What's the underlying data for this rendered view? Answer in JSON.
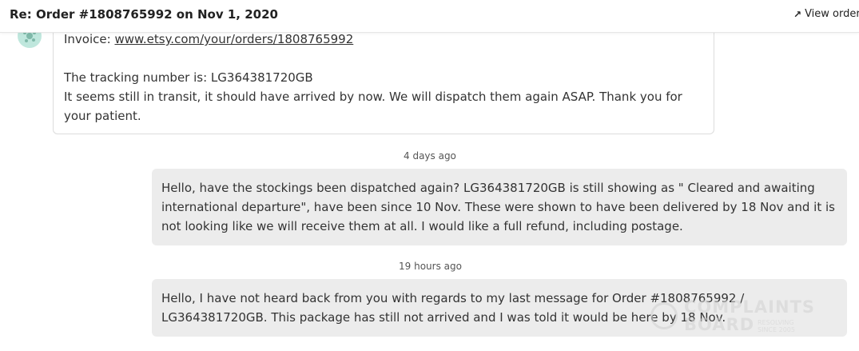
{
  "header": {
    "title": "Re: Order #1808765992 on Nov 1, 2020",
    "view_order_label": "View order"
  },
  "conversation": {
    "seller_message": {
      "invoice_prefix": "Invoice: ",
      "invoice_link": "www.etsy.com/your/orders/1808765992",
      "lines": [
        "The tracking number is: LG364381720GB",
        "It seems still in transit, it should have arrived by now. We will dispatch them again ASAP. Thank you for",
        "your patient."
      ]
    },
    "messages": [
      {
        "timestamp": "4 days ago",
        "lines": [
          "Hello, have the stockings been dispatched again? LG364381720GB is still showing as \" Cleared and awaiting",
          "international departure\", have been since 10 Nov. These were shown to have been delivered by 18 Nov and it is",
          "not looking like we will receive them at all. I would like a full refund, including postage."
        ]
      },
      {
        "timestamp": "19 hours ago",
        "lines": [
          "Hello, I have not heard back from you with regards to my last message for Order #1808765992 /",
          "LG364381720GB. This package has still not arrived and I was told it would be here by 18 Nov."
        ]
      }
    ]
  },
  "watermark": {
    "word1": "COMPLAINTS",
    "word2": "BOARD",
    "tagline_1": "RESOLVING",
    "tagline_2": "SINCE 2005"
  },
  "colors": {
    "buyer_bubble": "#ececec",
    "avatar": "#bfe7dd",
    "seller_border": "#dcdcdc"
  }
}
